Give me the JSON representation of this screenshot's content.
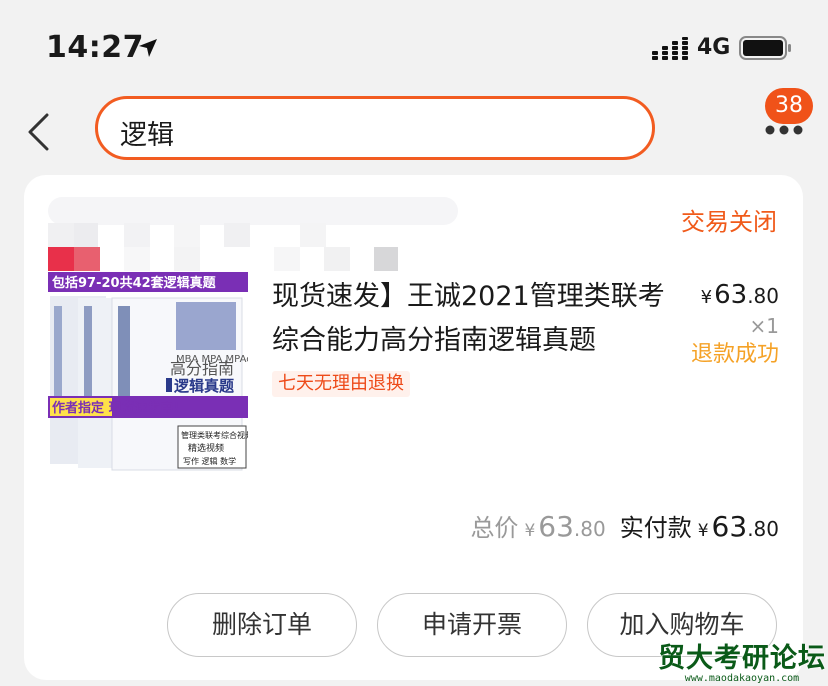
{
  "status_bar": {
    "time": "14:27",
    "network": "4G"
  },
  "nav": {
    "search_value": "逻辑",
    "badge_count": "38"
  },
  "order": {
    "status": "交易关闭",
    "thumbnail": {
      "banner_top": "包括97-20共42套逻辑真题",
      "book_title_1": "高分指南",
      "book_title_2": "逻辑真题",
      "banner_bottom": "作者指定 现货速发中!",
      "box_line1": "管理类联考综合视频",
      "box_line2": "精选视频",
      "box_line3": "写作 逻辑 数学",
      "small_text": "MBA MPA MPAcc MEM"
    },
    "title": "现货速发】王诚2021管理类联考综合能力高分指南逻辑真题",
    "tag": "七天无理由退换",
    "unit_price": {
      "currency": "¥",
      "integer": "63",
      "decimal": ".80"
    },
    "quantity": "×1",
    "refund_status": "退款成功",
    "total_label": "总价",
    "total": {
      "currency": "¥",
      "integer": "63",
      "decimal": ".80"
    },
    "paid_label": "实付款",
    "paid": {
      "currency": "¥",
      "integer": "63",
      "decimal": ".80"
    }
  },
  "actions": {
    "delete": "删除订单",
    "invoice": "申请开票",
    "add_cart": "加入购物车"
  },
  "watermark": {
    "name": "贸大考研论坛",
    "url": "www.maodakaoyan.com"
  },
  "colors": {
    "accent": "#f25c21",
    "refund": "#f5a227",
    "tag_bg": "#fff1ec"
  }
}
